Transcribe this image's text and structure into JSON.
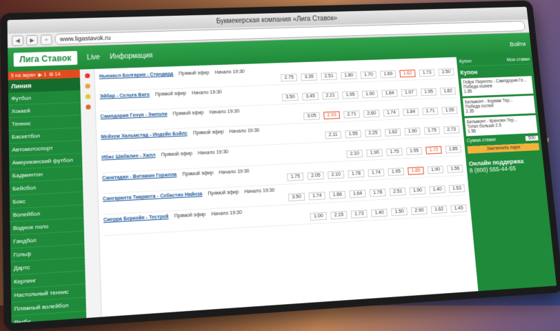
{
  "window_title": "Букмекерская компания «Лига Ставок»",
  "url": "www.ligastavok.ru",
  "header": {
    "logo": "Лига Ставок",
    "nav": [
      "Live",
      "Информация"
    ],
    "login": "Войти"
  },
  "sidebar": {
    "top": [
      "5 на экран",
      "▶ 1",
      "⊞ 14"
    ],
    "title": "Линия",
    "items": [
      "Футбол",
      "Хоккей",
      "Теннис",
      "Баскетбол",
      "Автомотоспорт",
      "Американский футбол",
      "Бадминтон",
      "Бейсбол",
      "Бокс",
      "Волейбол",
      "Водное поло",
      "Гандбол",
      "Гольф",
      "Дартс",
      "Керлинг",
      "Настольный теннис",
      "Пляжный волейбол",
      "Регби",
      "Снукер"
    ]
  },
  "events": [
    {
      "name": "Ньюкасл Болгария - Стандард",
      "filter": "Прямой эфир",
      "tags": [
        "Начало 19:30"
      ],
      "odds": [
        "2.75",
        "3.35",
        "2.51",
        "1.80",
        "1.70",
        "1.69",
        "1.62",
        "1.73",
        "2.50"
      ],
      "hl": 6
    },
    {
      "name": "Эйбар - Сельта Виго",
      "filter": "Прямой эфир",
      "tags": [
        "Начало 19:30"
      ],
      "odds": [
        "3.50",
        "3.45",
        "2.21",
        "1.95",
        "1.90",
        "1.84",
        "1.97",
        "1.95",
        "1.82"
      ],
      "hl": -1
    },
    {
      "name": "Сампдория Генуя - Эмполи",
      "filter": "Прямой эфир",
      "tags": [
        "Начало 19:30"
      ],
      "odds": [
        "3.05",
        "2.93",
        "2.71",
        "2.60",
        "1.74",
        "1.84",
        "1.71",
        "1.95"
      ],
      "hl": 1
    },
    {
      "name": "Мейхем Хальмстад - Индейн Бэйлс",
      "filter": "Прямой эфир",
      "tags": [
        "Начало 19:30"
      ],
      "odds": [
        "2.11",
        "1.55",
        "2.25",
        "1.62",
        "1.90",
        "1.75",
        "2.73"
      ],
      "hl": -1
    },
    {
      "name": "Ибис Шабалин - Хилл",
      "filter": "Прямой эфир",
      "tags": [
        "Начало 19:30"
      ],
      "odds": [
        "2.10",
        "1.90",
        "1.75",
        "1.95",
        "1.72",
        "1.85"
      ],
      "hl": 4
    },
    {
      "name": "Санктадан - Витамин Горилла",
      "filter": "Прямой эфир",
      "tags": [
        "Начало 19:30"
      ],
      "odds": [
        "1.75",
        "2.05",
        "2.10",
        "1.78",
        "1.74",
        "1.95",
        "1.85",
        "1.90",
        "1.56"
      ],
      "hl": 6
    },
    {
      "name": "Сангаранта Тиаранта - Себастио Найнза",
      "filter": "Прямой эфир",
      "tags": [
        "Начало 19:30"
      ],
      "odds": [
        "3.50",
        "1.74",
        "1.86",
        "1.64",
        "1.78",
        "2.51",
        "1.90",
        "1.40",
        "1.53"
      ],
      "hl": -1
    },
    {
      "name": "Сиерра Беркойя - Тестрей",
      "filter": "Прямой эфир",
      "tags": [
        "Начало 19:30"
      ],
      "odds": [
        "1.00",
        "2.15",
        "1.73",
        "1.40",
        "1.50",
        "2.90",
        "1.62",
        "1.45"
      ],
      "hl": -1
    }
  ],
  "right": {
    "head": [
      "Купон",
      "Мои ставки"
    ],
    "title": "Купон",
    "coupons": [
      {
        "name": "Гейре Пирелло - Сампдория Ге...",
        "detail": "Победа хозяев",
        "odd": "1.85"
      },
      {
        "name": "Бельмонт - Кормак Тер...",
        "detail": "Победа гостей",
        "odd": "2.35"
      },
      {
        "name": "Бельмонт - Кренлен Тер...",
        "detail": "Тотал больше 2.5",
        "odd": "1.56"
      }
    ],
    "sum_label": "Сумма ставки",
    "sum": "500",
    "bet": "Заключить пари",
    "support": "Онлайн поддержка",
    "phone": "8 (800) 555-44-55"
  }
}
